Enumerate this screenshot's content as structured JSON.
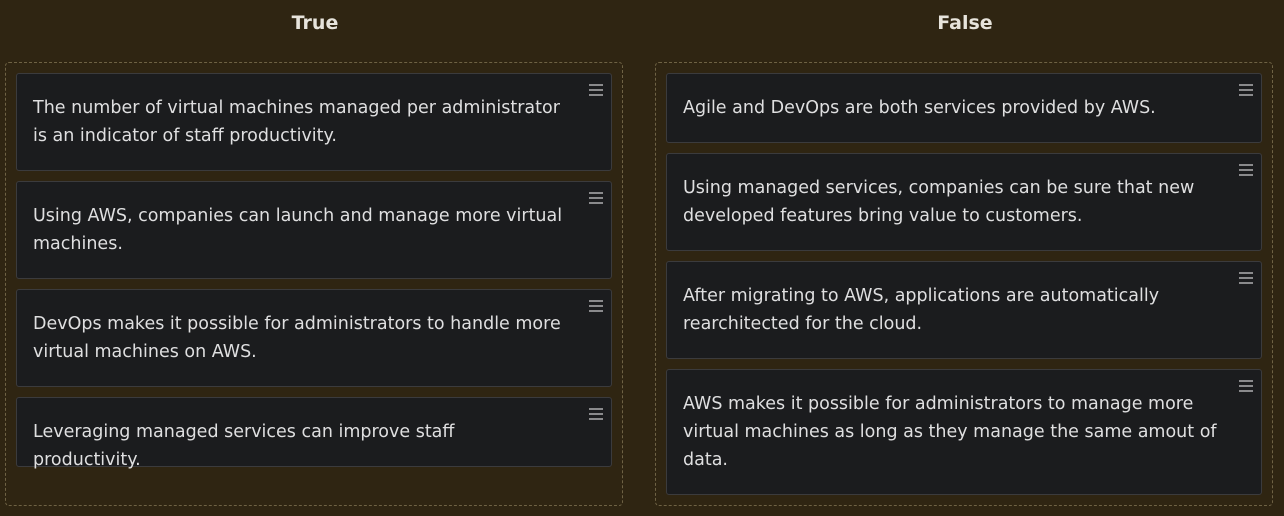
{
  "columns": {
    "true": {
      "title": "True",
      "cards": [
        "The number of virtual machines managed per administrator is an indicator of staff productivity.",
        "Using AWS, companies can launch and manage more virtual machines.",
        "DevOps makes it possible for administrators to handle more virtual machines on AWS.",
        "Leveraging managed services can improve staff productivity."
      ]
    },
    "false": {
      "title": "False",
      "cards": [
        "Agile and DevOps are both services provided by AWS.",
        "Using managed services, companies can be sure that new developed features bring value to customers.",
        "After migrating to AWS, applications are automatically rearchitected for the cloud.",
        "AWS makes it possible for administrators to manage more virtual machines as long as they manage the same amout of data."
      ]
    }
  },
  "icons": {
    "drag_handle": "drag-handle-icon"
  },
  "colors": {
    "background": "#2f2512",
    "card_background": "#1b1c1e",
    "card_border": "#3b3b3d",
    "title_text": "#e7e4dc",
    "card_text": "#dfdfe0",
    "drop_zone_border": "#6e6244"
  }
}
